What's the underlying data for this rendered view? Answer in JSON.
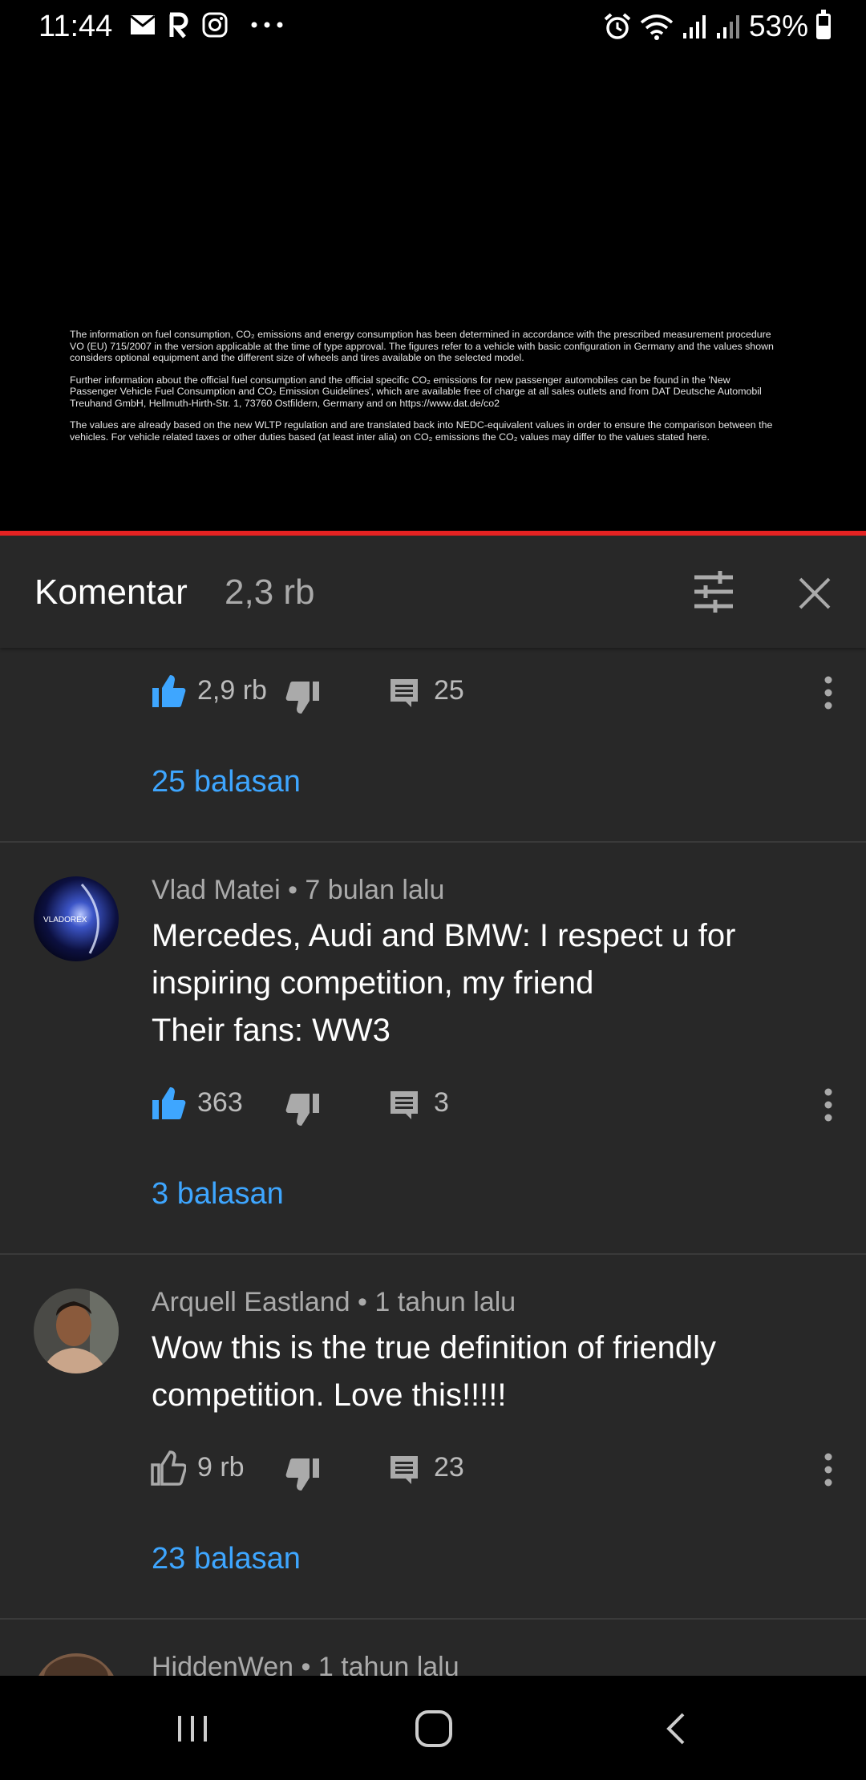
{
  "status_bar": {
    "time": "11:44",
    "left_icons": [
      "mail-icon",
      "app-icon",
      "instagram-icon",
      "more-dots-icon"
    ],
    "right_icons": [
      "alarm-icon",
      "wifi-icon",
      "signal-icon",
      "signal-icon"
    ],
    "battery_text": "53%",
    "battery_level": 0.53
  },
  "video": {
    "disclaimer": [
      "The information on fuel consumption, CO₂ emissions and energy consumption has been determined in accordance with the prescribed measurement procedure VO (EU) 715/2007 in the version applicable at the time of type approval. The figures refer to a vehicle with basic configuration in Germany and the values shown considers optional equipment and the different size of wheels and tires available on the selected model.",
      "Further information about the official fuel consumption and the official specific CO₂ emissions for new passenger automobiles can be found in the 'New Passenger Vehicle Fuel Consumption and CO₂ Emission Guidelines', which are available free of charge at all sales outlets and from DAT Deutsche Automobil Treuhand GmbH, Hellmuth-Hirth-Str. 1, 73760 Ostfildern, Germany and on https://www.dat.de/co2",
      "The values are already based on the new WLTP regulation and are translated back into NEDC-equivalent values in order to ensure the comparison between the vehicles. For vehicle related taxes or other duties based (at least inter alia) on CO₂ emissions the CO₂ values may differ to the values stated here."
    ],
    "progress": 1.0,
    "progress_color": "#e52222"
  },
  "panel": {
    "title": "Komentar",
    "count": "2,3 rb",
    "accent_color": "#3ea6ff"
  },
  "comments": [
    {
      "author": "",
      "time": "",
      "text": "",
      "likes": "2,9 rb",
      "liked": true,
      "reply_count": "25",
      "replies_label": "25 balasan"
    },
    {
      "author": "Vlad Matei",
      "time": "7 bulan lalu",
      "meta": "Vlad Matei • 7 bulan lalu",
      "text_lines": [
        "Mercedes, Audi and BMW: I respect u for",
        "inspiring competition, my friend",
        "Their fans: WW3"
      ],
      "avatar_text": "VLADOREX",
      "likes": "363",
      "liked": true,
      "reply_count": "3",
      "replies_label": "3 balasan"
    },
    {
      "author": "Arquell Eastland",
      "time": "1 tahun lalu",
      "meta": "Arquell Eastland • 1 tahun lalu",
      "text_lines": [
        "Wow this is the true definition of friendly",
        "competition. Love this!!!!!"
      ],
      "likes": "9 rb",
      "liked": false,
      "reply_count": "23",
      "replies_label": "23 balasan"
    },
    {
      "author": "HiddenWen",
      "time": "1 tahun lalu",
      "meta": "HiddenWen • 1 tahun lalu"
    }
  ],
  "nav": [
    "recent-apps-icon",
    "home-icon",
    "back-icon"
  ]
}
